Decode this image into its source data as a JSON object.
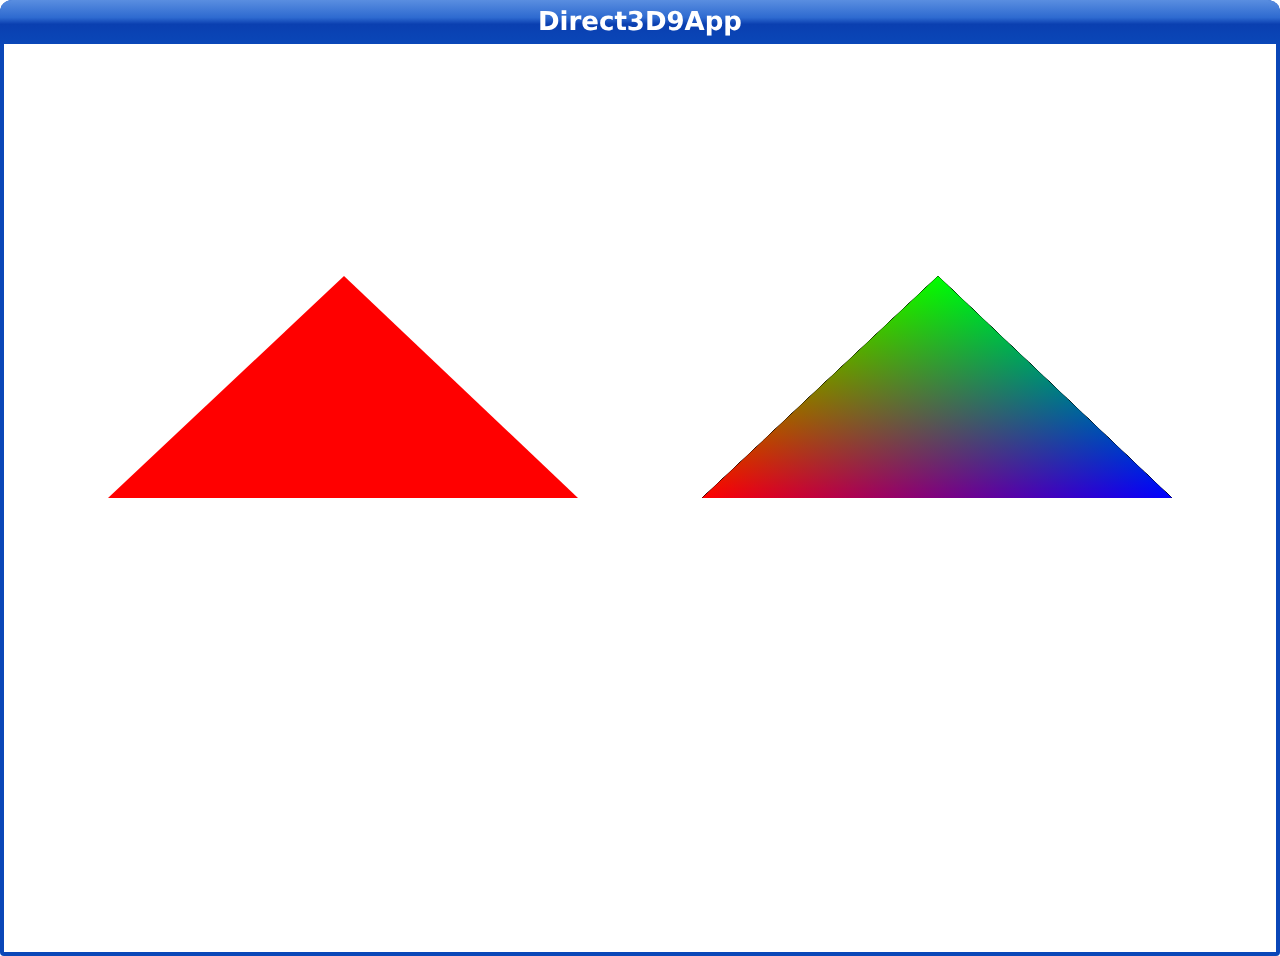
{
  "window": {
    "title": "Direct3D9App"
  }
}
